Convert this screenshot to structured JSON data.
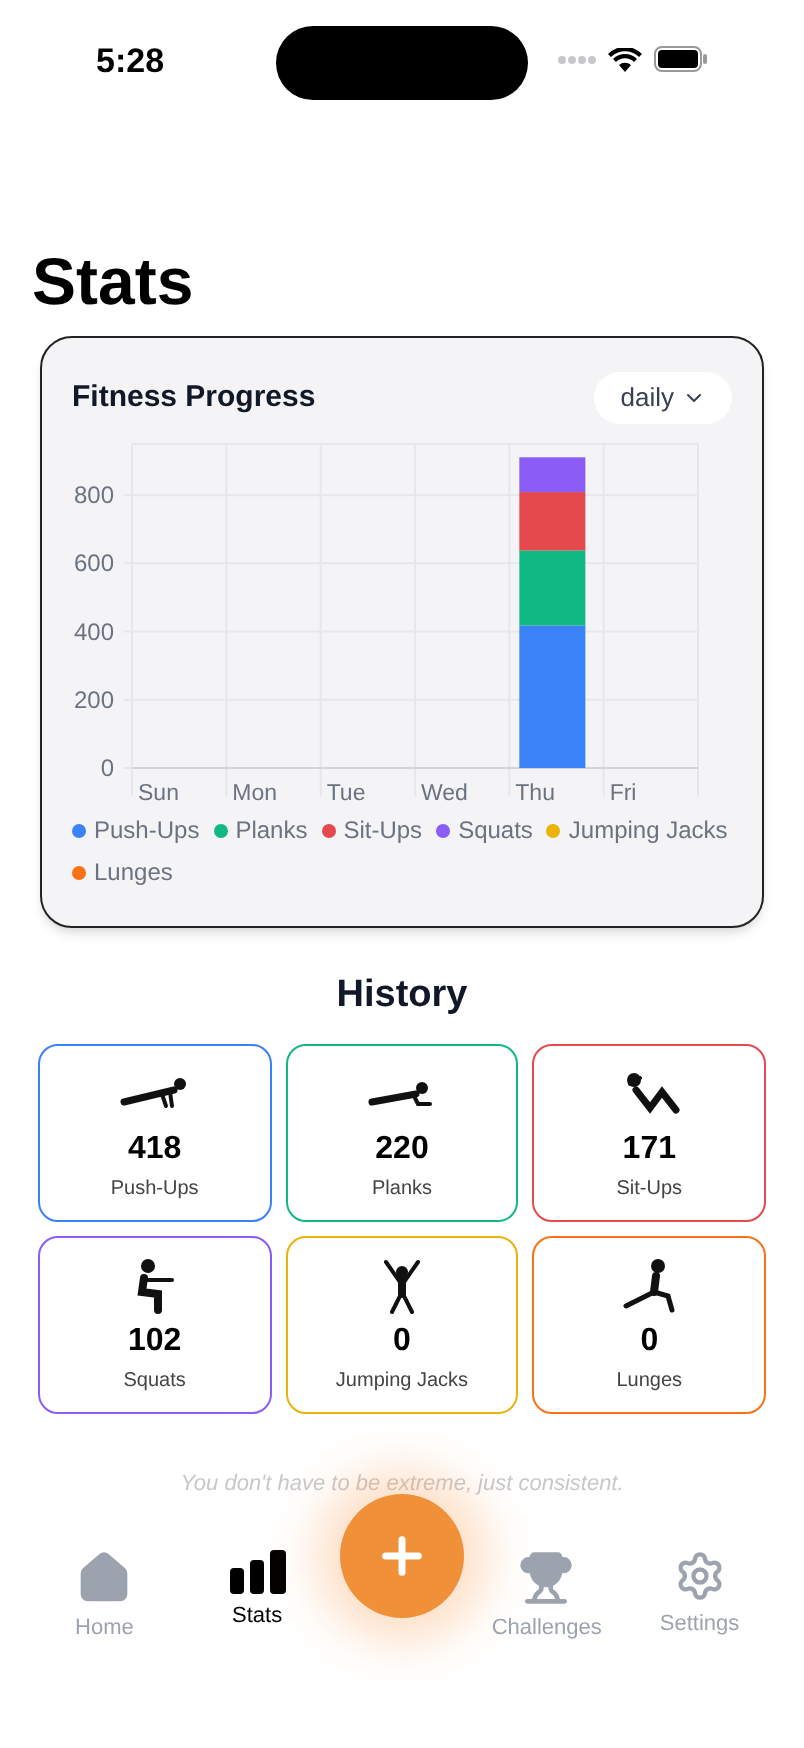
{
  "status_bar": {
    "time": "5:28"
  },
  "title": "Stats",
  "progress_card": {
    "title": "Fitness Progress",
    "period_dropdown": "daily",
    "chart_data": {
      "type": "bar",
      "stacked": true,
      "categories": [
        "Sun",
        "Mon",
        "Tue",
        "Wed",
        "Thu",
        "Fri"
      ],
      "ylim": [
        0,
        950
      ],
      "yticks": [
        0,
        200,
        400,
        600,
        800
      ],
      "grid": true,
      "series": [
        {
          "name": "Push-Ups",
          "color": "#3b82f6",
          "values": [
            0,
            0,
            0,
            0,
            418,
            0
          ]
        },
        {
          "name": "Planks",
          "color": "#10b981",
          "values": [
            0,
            0,
            0,
            0,
            220,
            0
          ]
        },
        {
          "name": "Sit-Ups",
          "color": "#e5484d",
          "values": [
            0,
            0,
            0,
            0,
            171,
            0
          ]
        },
        {
          "name": "Squats",
          "color": "#8b5cf6",
          "values": [
            0,
            0,
            0,
            0,
            102,
            0
          ]
        },
        {
          "name": "Jumping Jacks",
          "color": "#eab308",
          "values": [
            0,
            0,
            0,
            0,
            0,
            0
          ]
        },
        {
          "name": "Lunges",
          "color": "#f97316",
          "values": [
            0,
            0,
            0,
            0,
            0,
            0
          ]
        }
      ]
    }
  },
  "history": {
    "title": "History",
    "items": [
      {
        "kind": "pushup",
        "count": "418",
        "label": "Push-Ups",
        "color": "#3b82f6"
      },
      {
        "kind": "plank",
        "count": "220",
        "label": "Planks",
        "color": "#10b981"
      },
      {
        "kind": "situp",
        "count": "171",
        "label": "Sit-Ups",
        "color": "#e5484d"
      },
      {
        "kind": "squat",
        "count": "102",
        "label": "Squats",
        "color": "#8b5cf6"
      },
      {
        "kind": "jumpingjack",
        "count": "0",
        "label": "Jumping Jacks",
        "color": "#eab308"
      },
      {
        "kind": "lunge",
        "count": "0",
        "label": "Lunges",
        "color": "#f97316"
      }
    ]
  },
  "quote": "You don't have to be extreme, just consistent.",
  "tab_bar": [
    {
      "kind": "home",
      "label": "Home",
      "selected": false
    },
    {
      "kind": "stats",
      "label": "Stats",
      "selected": true
    },
    {
      "kind": "add"
    },
    {
      "kind": "trophy",
      "label": "Challenges",
      "selected": false
    },
    {
      "kind": "gear",
      "label": "Settings",
      "selected": false
    }
  ]
}
